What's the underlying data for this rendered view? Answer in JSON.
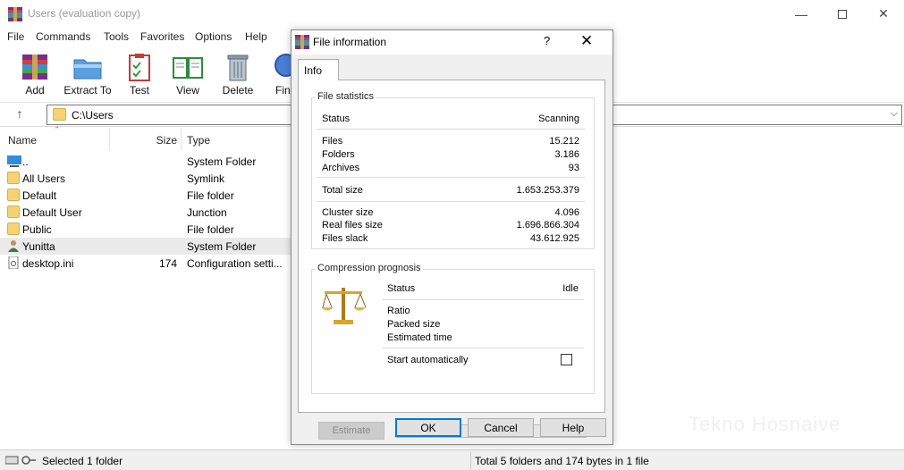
{
  "window": {
    "title": "Users (evaluation copy)"
  },
  "menu": [
    "File",
    "Commands",
    "Tools",
    "Favorites",
    "Options",
    "Help"
  ],
  "toolbar": {
    "add": "Add",
    "extract_to": "Extract To",
    "test": "Test",
    "view": "View",
    "delete": "Delete",
    "find": "Fin"
  },
  "address": {
    "path": "C:\\Users"
  },
  "filelist": {
    "columns": {
      "name": "Name",
      "size": "Size",
      "type": "Type"
    },
    "rows": [
      {
        "name": "..",
        "size": "",
        "type": "System Folder",
        "icon": "drive-icon"
      },
      {
        "name": "All Users",
        "size": "",
        "type": "Symlink",
        "icon": "folder-icon"
      },
      {
        "name": "Default",
        "size": "",
        "type": "File folder",
        "icon": "folder-icon"
      },
      {
        "name": "Default User",
        "size": "",
        "type": "Junction",
        "icon": "folder-icon"
      },
      {
        "name": "Public",
        "size": "",
        "type": "File folder",
        "icon": "folder-icon"
      },
      {
        "name": "Yunitta",
        "size": "",
        "type": "System Folder",
        "icon": "user-icon"
      },
      {
        "name": "desktop.ini",
        "size": "174",
        "type": "Configuration setti...",
        "icon": "ini-file-icon"
      }
    ]
  },
  "watermark": "Tekno Hosnaive",
  "statusbar": {
    "left": "Selected 1 folder",
    "right": "Total 5 folders and 174 bytes in 1 file"
  },
  "dialog": {
    "title": "File information",
    "help": "?",
    "close": "✕",
    "tab": "Info",
    "file_statistics": {
      "title": "File statistics",
      "status_label": "Status",
      "status_value": "Scanning",
      "files_label": "Files",
      "files_value": "15.212",
      "folders_label": "Folders",
      "folders_value": "3.186",
      "archives_label": "Archives",
      "archives_value": "93",
      "total_size_label": "Total size",
      "total_size_value": "1.653.253.379",
      "cluster_size_label": "Cluster size",
      "cluster_size_value": "4.096",
      "real_files_size_label": "Real files size",
      "real_files_size_value": "1.696.866.304",
      "files_slack_label": "Files slack",
      "files_slack_value": "43.612.925"
    },
    "compression": {
      "title": "Compression prognosis",
      "status_label": "Status",
      "status_value": "Idle",
      "ratio_label": "Ratio",
      "packed_size_label": "Packed size",
      "estimated_time_label": "Estimated time",
      "start_auto_label": "Start automatically",
      "start_auto_checked": false,
      "estimate_button": "Estimate"
    },
    "buttons": {
      "ok": "OK",
      "cancel": "Cancel",
      "help": "Help"
    }
  },
  "colors": {
    "accent": "#0078d7",
    "folder": "#f6d277"
  }
}
